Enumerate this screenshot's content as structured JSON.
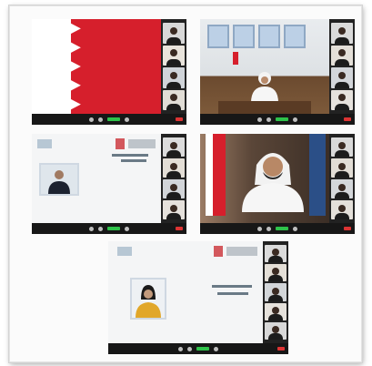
{
  "collage": {
    "title": "",
    "panels": [
      {
        "id": "flag-view",
        "content": "flag",
        "toolbar": "meeting-controls"
      },
      {
        "id": "office-view",
        "content": "speaker-at-desk",
        "toolbar": "meeting-controls"
      },
      {
        "id": "slide-view-1",
        "content": "presentation-with-video",
        "toolbar": "meeting-controls"
      },
      {
        "id": "speaker-view",
        "content": "speaker-with-flag",
        "toolbar": "meeting-controls"
      },
      {
        "id": "slide-view-2",
        "content": "presentation-with-video",
        "toolbar": "meeting-controls"
      }
    ]
  },
  "colors": {
    "flag_red": "#d61f2c",
    "toolbar_bg": "#171717",
    "accent_green": "#2ec24a",
    "end_red": "#d33"
  },
  "icons": [
    "mute-icon",
    "video-icon",
    "share-icon",
    "participants-icon",
    "end-call-icon"
  ]
}
